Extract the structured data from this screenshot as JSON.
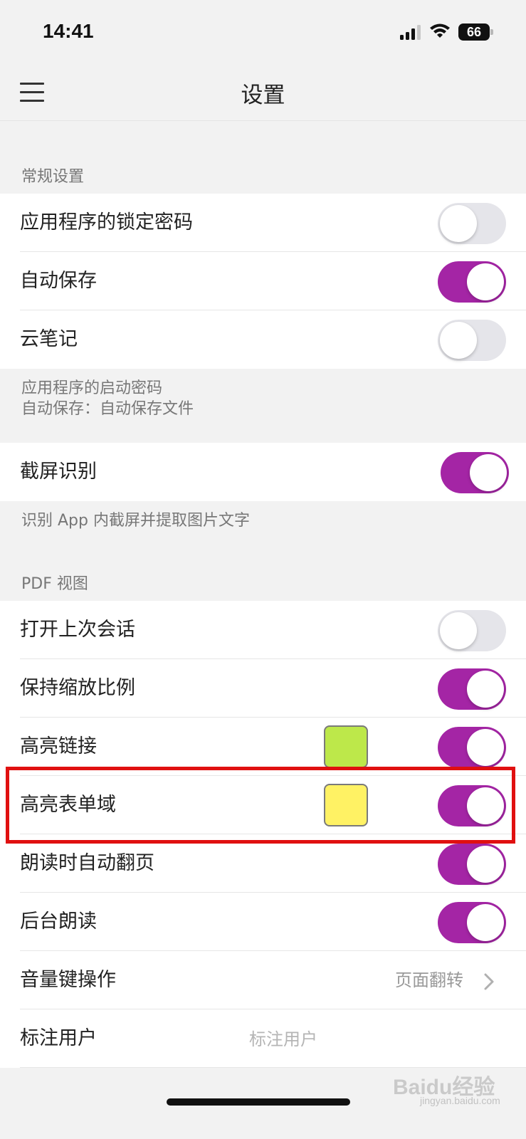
{
  "status_bar": {
    "time": "14:41",
    "battery": "66",
    "icons": [
      "signal-icon",
      "wifi-icon",
      "battery-icon"
    ]
  },
  "nav": {
    "title": "设置",
    "menu_icon": "menu-icon"
  },
  "general": {
    "header": "常规设置",
    "items": [
      {
        "label": "应用程序的锁定密码",
        "on": false
      },
      {
        "label": "自动保存",
        "on": true
      },
      {
        "label": "云笔记",
        "on": false
      }
    ],
    "footer_line1": "应用程序的启动密码",
    "footer_line2": "自动保存：自动保存文件"
  },
  "screenshot": {
    "label": "截屏识别",
    "on": true,
    "footer": "识别 App 内截屏并提取图片文字"
  },
  "pdf": {
    "header": "PDF 视图",
    "items": [
      {
        "label": "打开上次会话",
        "on": false
      },
      {
        "label": "保持缩放比例",
        "on": true
      },
      {
        "label": "高亮链接",
        "on": true,
        "color": "#bde84a"
      },
      {
        "label": "高亮表单域",
        "on": true,
        "color": "#fff264"
      },
      {
        "label": "朗读时自动翻页",
        "on": true
      },
      {
        "label": "后台朗读",
        "on": true
      }
    ],
    "volume_key": {
      "label": "音量键操作",
      "value": "页面翻转",
      "icon": "chevron-right-icon"
    },
    "annotation_user": {
      "label": "标注用户",
      "placeholder": "标注用户"
    }
  },
  "colors": {
    "toggle_on": "#a425a5",
    "toggle_off": "#e5e5ea",
    "highlight_frame": "#e01010"
  },
  "watermark": {
    "brand": "Baidu经验",
    "url": "jingyan.baidu.com"
  }
}
